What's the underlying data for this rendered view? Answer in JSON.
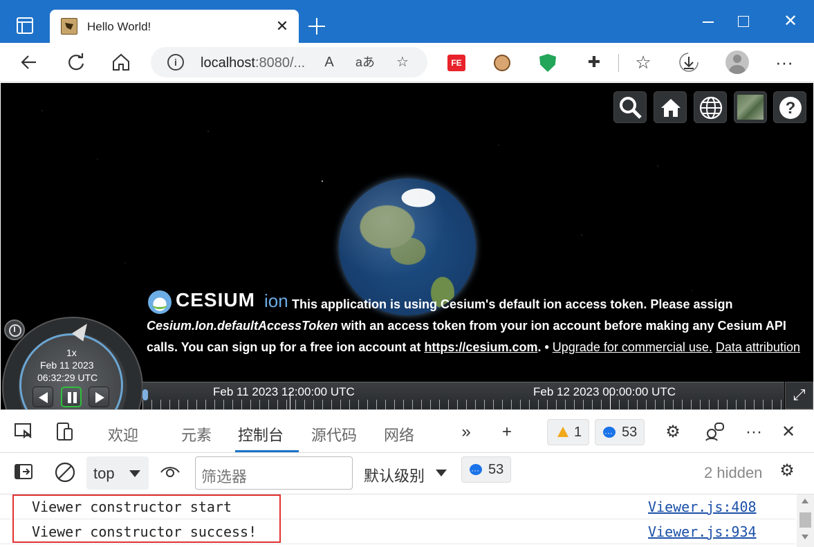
{
  "browser": {
    "tab_title": "Hello World!",
    "tab_close": "✕",
    "window_close": "✕",
    "address_host": "localhost",
    "address_rest": ":8080/...",
    "read_aloud": "A",
    "translate": "aあ"
  },
  "extensions": {
    "fe_label": "FE"
  },
  "viewer": {
    "credits": {
      "logo_word": "CESIUM",
      "logo_ion": "ion",
      "text1": "This application is using Cesium's default ion access token. Please assign",
      "token_name": "Cesium.Ion.defaultAccessToken",
      "text2": " with an access token from your ion account before making any Cesium API calls. You can sign up for a free ion account at ",
      "link_site": "https://cesium.com",
      "text3": ". • ",
      "link_upgrade": "Upgrade for commercial use.",
      "link_data": "Data attribution"
    },
    "animation": {
      "speed": "1x",
      "date": "Feb 11 2023",
      "time": "06:32:29 UTC"
    },
    "timeline": {
      "label_1": "Feb 11 2023 12:00:00 UTC",
      "label_2": "Feb 12 2023 00:00:00 UTC"
    },
    "help_label": "?"
  },
  "devtools": {
    "tabs": [
      "欢迎",
      "元素",
      "控制台",
      "源代码",
      "网络"
    ],
    "active_tab": "控制台",
    "warnings_count": "1",
    "messages_count": "53",
    "filter": {
      "context": "top",
      "placeholder": "筛选器",
      "level": "默认级别",
      "messages_count": "53",
      "hidden": "2 hidden"
    },
    "console_rows": [
      {
        "message": "Viewer constructor start",
        "source": "Viewer.js:408"
      },
      {
        "message": "Viewer constructor success!",
        "source": "Viewer.js:934"
      }
    ]
  }
}
